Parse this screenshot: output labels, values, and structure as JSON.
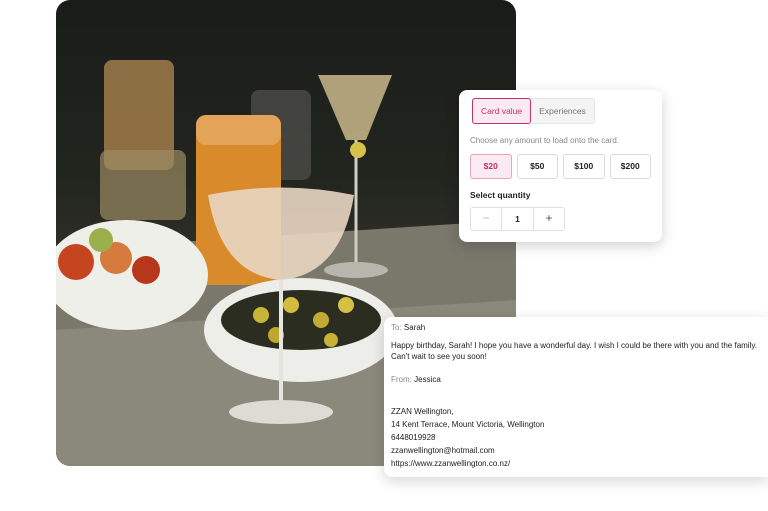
{
  "photo": {
    "description_icon": "cocktail-table-photo-icon"
  },
  "gift_card": {
    "tabs": [
      {
        "label": "Card value",
        "active": true
      },
      {
        "label": "Experiences",
        "active": false
      }
    ],
    "hint": "Choose any amount to load onto the card.",
    "amounts": [
      "$20",
      "$50",
      "$100",
      "$200"
    ],
    "selected_amount": "$20",
    "quantity_label": "Select quantity",
    "quantity": "1",
    "minus": "−",
    "plus": "+",
    "accent_color": "#c2326b"
  },
  "message": {
    "to_label": "To:",
    "to_name": "Sarah",
    "body": "Happy birthday, Sarah! I hope you have a wonderful day. I wish I could be there with you and the family. Can't wait to see you soon!",
    "from_label": "From:",
    "from_name": "Jessica",
    "address_lines": [
      "ZZAN Wellington,",
      "14 Kent Terrace, Mount Victoria, Wellington",
      "6448019928",
      "zzanwellington@hotmail.com",
      "https://www.zzanwellington.co.nz/"
    ]
  }
}
